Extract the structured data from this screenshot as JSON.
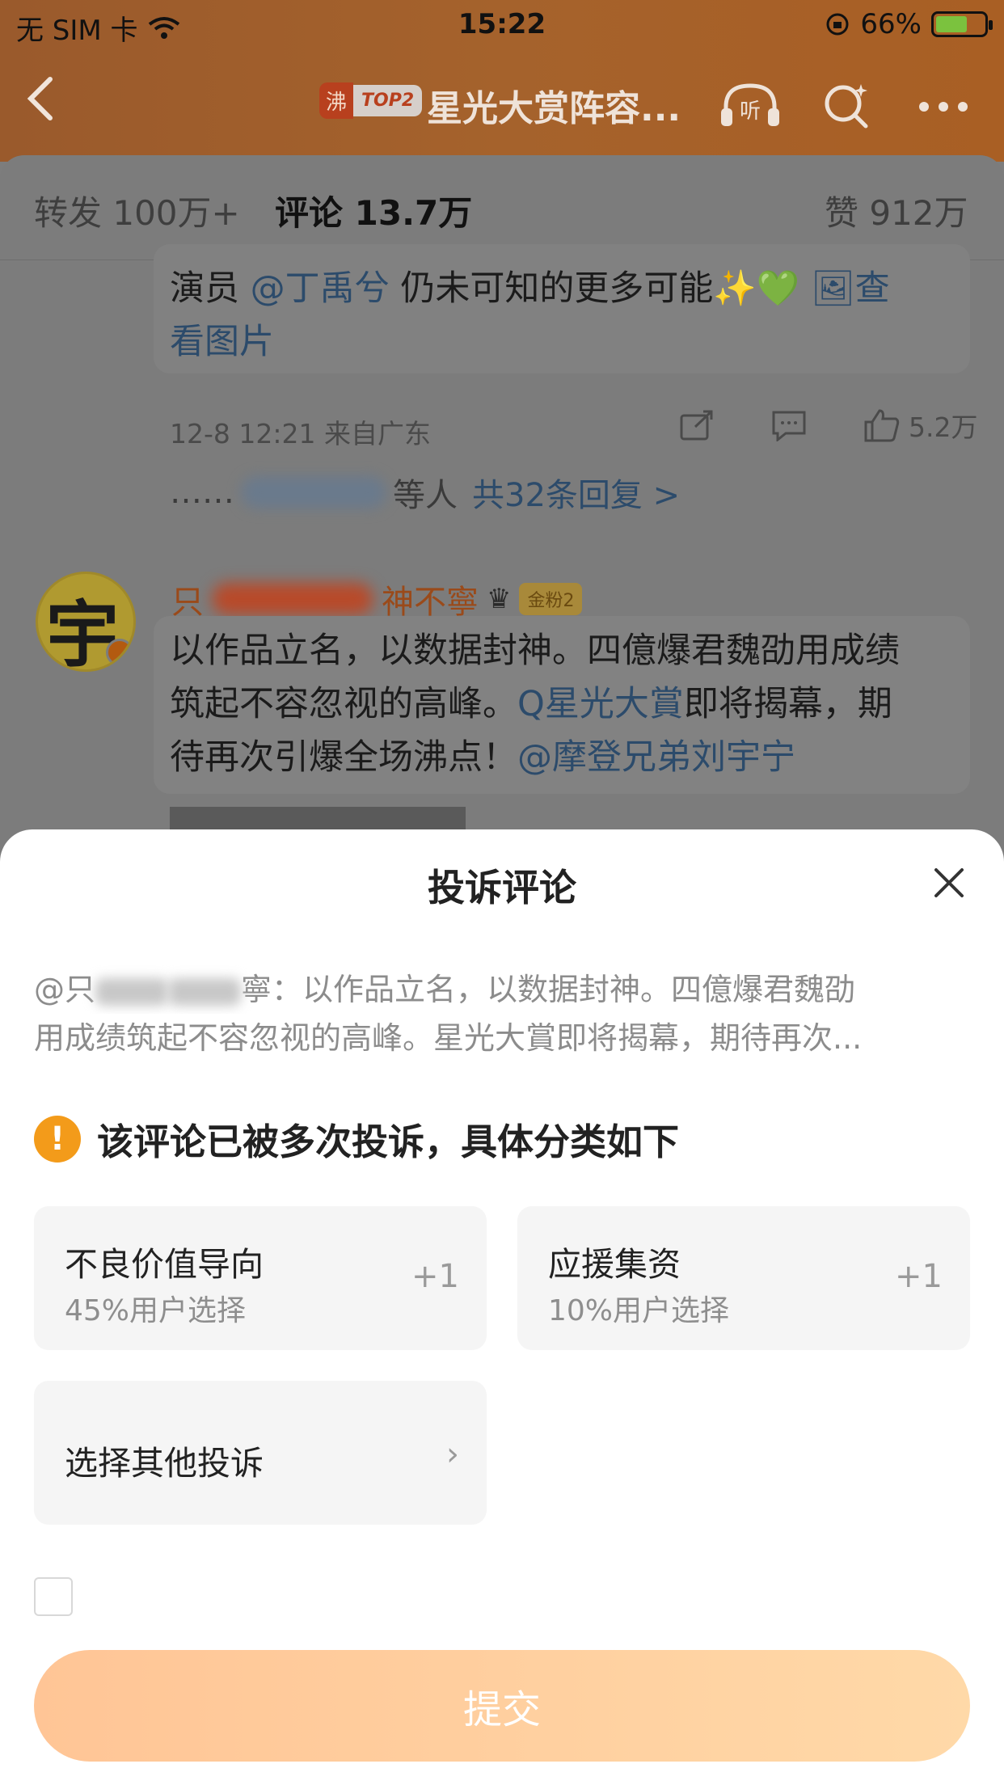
{
  "status_bar": {
    "carrier": "无 SIM 卡",
    "time": "15:22",
    "battery_percent": "66%",
    "battery_level": 0.66
  },
  "nav": {
    "back_icon": "chevron-left-icon",
    "hot_tag": "沸",
    "hot_rank": "TOP2",
    "title": "星光大赏阵容...",
    "listen_label": "听",
    "more_icon": "more-dots-icon"
  },
  "tabs": {
    "repost": "转发 100万+",
    "comments": "评论 13.7万",
    "likes": "赞 912万"
  },
  "post": {
    "line1_prefix": "演员 ",
    "line1_mention": "@丁禹兮",
    "line1_rest": " 仍未可知的更多可能✨💚",
    "view_image_label": "🖼查",
    "line2": "看图片",
    "timestamp": "12-8 12:21 来自广东",
    "like_count": "5.2万",
    "replies_prefix": "……",
    "replies_suffix": "等人",
    "replies_link": "共32条回复 >"
  },
  "comment": {
    "username_visible_start": "只",
    "username_visible_end": "神不寧",
    "fan_badge": "金粉2",
    "line1": "以作品立名，以数据封神。四億爆君魏劭用成绩",
    "line2_a": "筑起不容忽视的高峰。",
    "line2_link": "Q星光大賞",
    "line2_b": "即将揭幕，期",
    "line3_a": "待再次引爆全场沸点！",
    "line3_link": "@摩登兄弟刘宇宁"
  },
  "sheet": {
    "title": "投诉评论",
    "preview_line1_a": "@只",
    "preview_line1_b": "寧：以作品立名，以数据封神。四億爆君魏劭",
    "preview_line2": "用成绩筑起不容忽视的高峰。星光大賞即将揭幕，期待再次...",
    "notice": "该评论已被多次投诉，具体分类如下",
    "options": [
      {
        "label": "不良价值导向",
        "sub": "45%用户选择",
        "plus": "+1"
      },
      {
        "label": "应援集资",
        "sub": "10%用户选择",
        "plus": "+1"
      }
    ],
    "other_option": "选择其他投诉",
    "submit": "提交"
  }
}
